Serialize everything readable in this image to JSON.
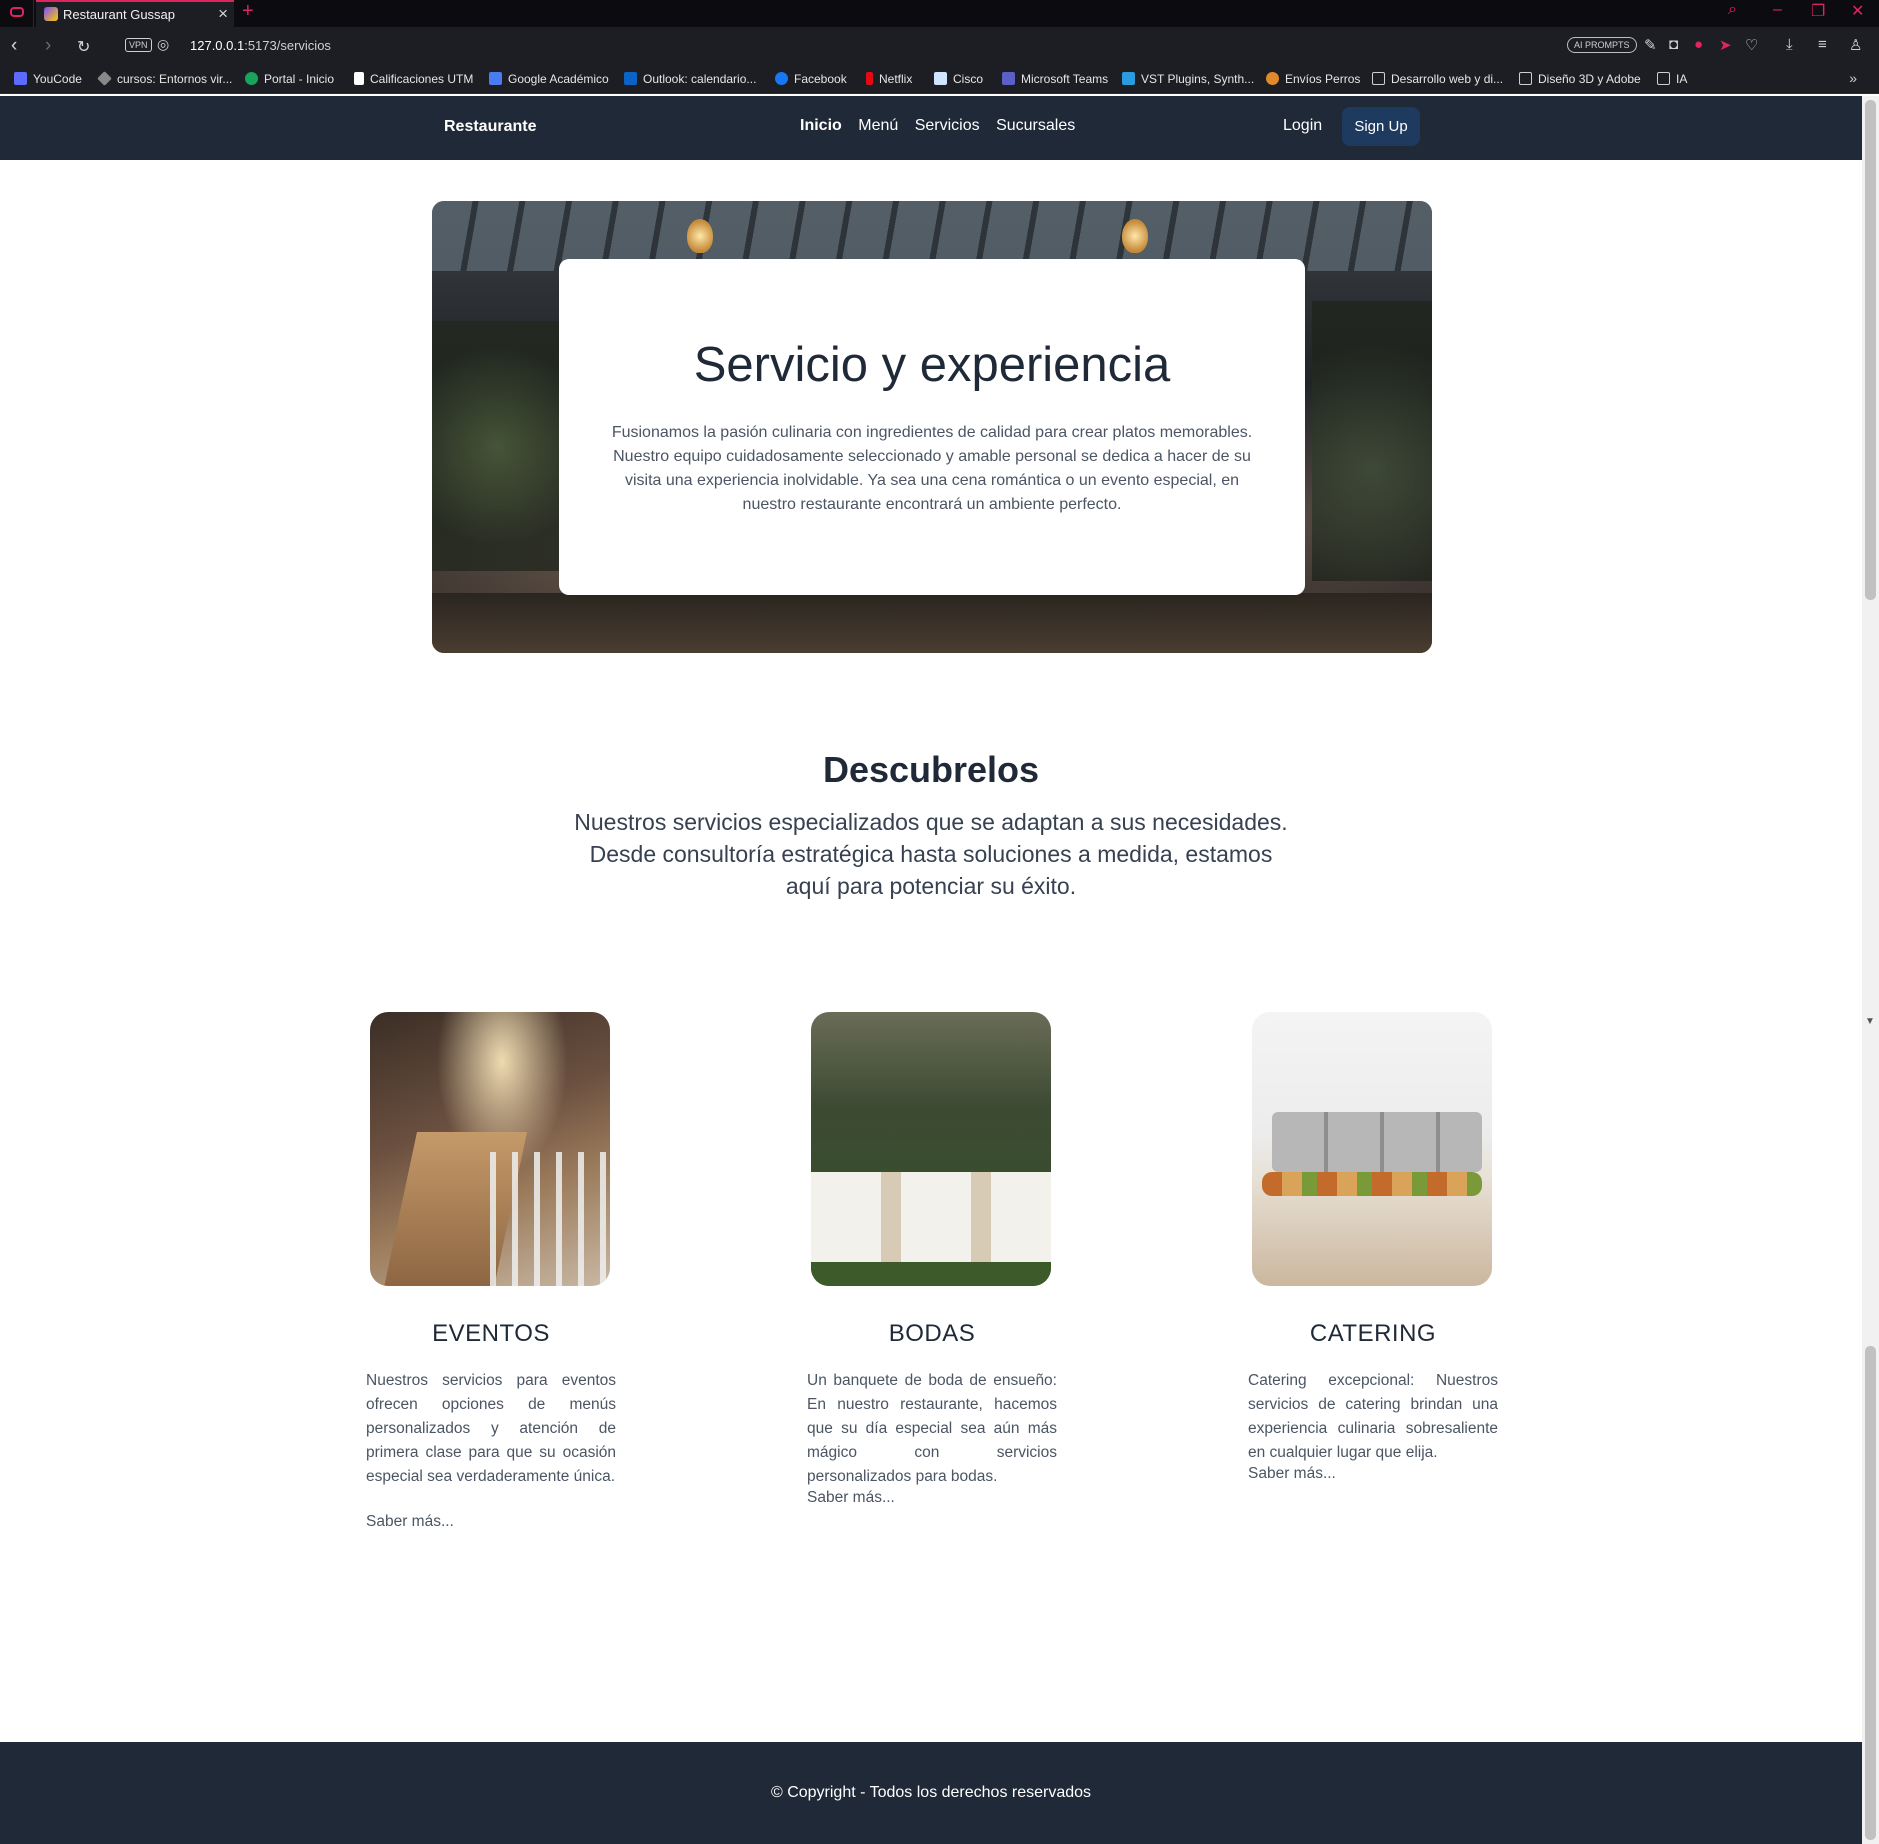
{
  "browser": {
    "tab_title": "Restaurant Gussap",
    "url_host": "127.0.0.1",
    "url_path": ":5173/servicios",
    "vpn_label": "VPN",
    "ai_prompts_label": "AI PROMPTS",
    "bookmarks": [
      {
        "label": "YouCode",
        "icon_color": "#5b6bff"
      },
      {
        "label": "cursos: Entornos vir...",
        "icon_color": "#888888"
      },
      {
        "label": "Portal - Inicio",
        "icon_color": "#1aa35a"
      },
      {
        "label": "Calificaciones UTM",
        "icon_color": "#ffffff"
      },
      {
        "label": "Google Académico",
        "icon_color": "#4a7cf0"
      },
      {
        "label": "Outlook: calendario...",
        "icon_color": "#0a64c8"
      },
      {
        "label": "Facebook",
        "icon_color": "#1877f2"
      },
      {
        "label": "Netflix",
        "icon_color": "#e50914"
      },
      {
        "label": "Cisco",
        "icon_color": "#cfe4ff"
      },
      {
        "label": "Microsoft Teams",
        "icon_color": "#5b5fc7"
      },
      {
        "label": "VST Plugins, Synth...",
        "icon_color": "#2b9be0"
      },
      {
        "label": "Envíos Perros",
        "icon_color": "#e08a2b"
      },
      {
        "label": "Desarrollo web y di...",
        "icon_color": "folder"
      },
      {
        "label": "Diseño 3D y Adobe",
        "icon_color": "folder"
      },
      {
        "label": "IA",
        "icon_color": "folder"
      }
    ]
  },
  "navbar": {
    "brand": "Restaurante",
    "links": [
      "Inicio",
      "Menú",
      "Servicios",
      "Sucursales"
    ],
    "active_link": "Inicio",
    "login": "Login",
    "signup": "Sign Up"
  },
  "hero": {
    "title": "Servicio y experiencia",
    "text": "Fusionamos la pasión culinaria con ingredientes de calidad para crear platos memorables. Nuestro equipo cuidadosamente seleccionado y amable personal se dedica a hacer de su visita una experiencia inolvidable. Ya sea una cena romántica o un evento especial, en nuestro restaurante encontrará un ambiente perfecto."
  },
  "discover": {
    "title": "Descubrelos",
    "subtitle": "Nuestros servicios especializados que se adaptan a sus necesidades. Desde consultoría estratégica hasta soluciones a medida, estamos aquí para potenciar su éxito."
  },
  "services": [
    {
      "title": "EVENTOS",
      "text": "Nuestros servicios para eventos ofrecen opciones de menús personalizados y atención de primera clase para que su ocasión especial sea verdaderamente única.",
      "more": "Saber más..."
    },
    {
      "title": "BODAS",
      "text": "Un banquete de boda de ensueño: En nuestro restaurante, hacemos que su día especial sea aún más mágico con servicios personalizados para bodas.",
      "more": "Saber más..."
    },
    {
      "title": "CATERING",
      "text": "Catering excepcional: Nuestros servicios de catering brindan una experiencia culinaria sobresaliente en cualquier lugar que elija.",
      "more": "Saber más..."
    }
  ],
  "footer": {
    "copyright": "© Copyright - Todos los derechos reservados"
  }
}
